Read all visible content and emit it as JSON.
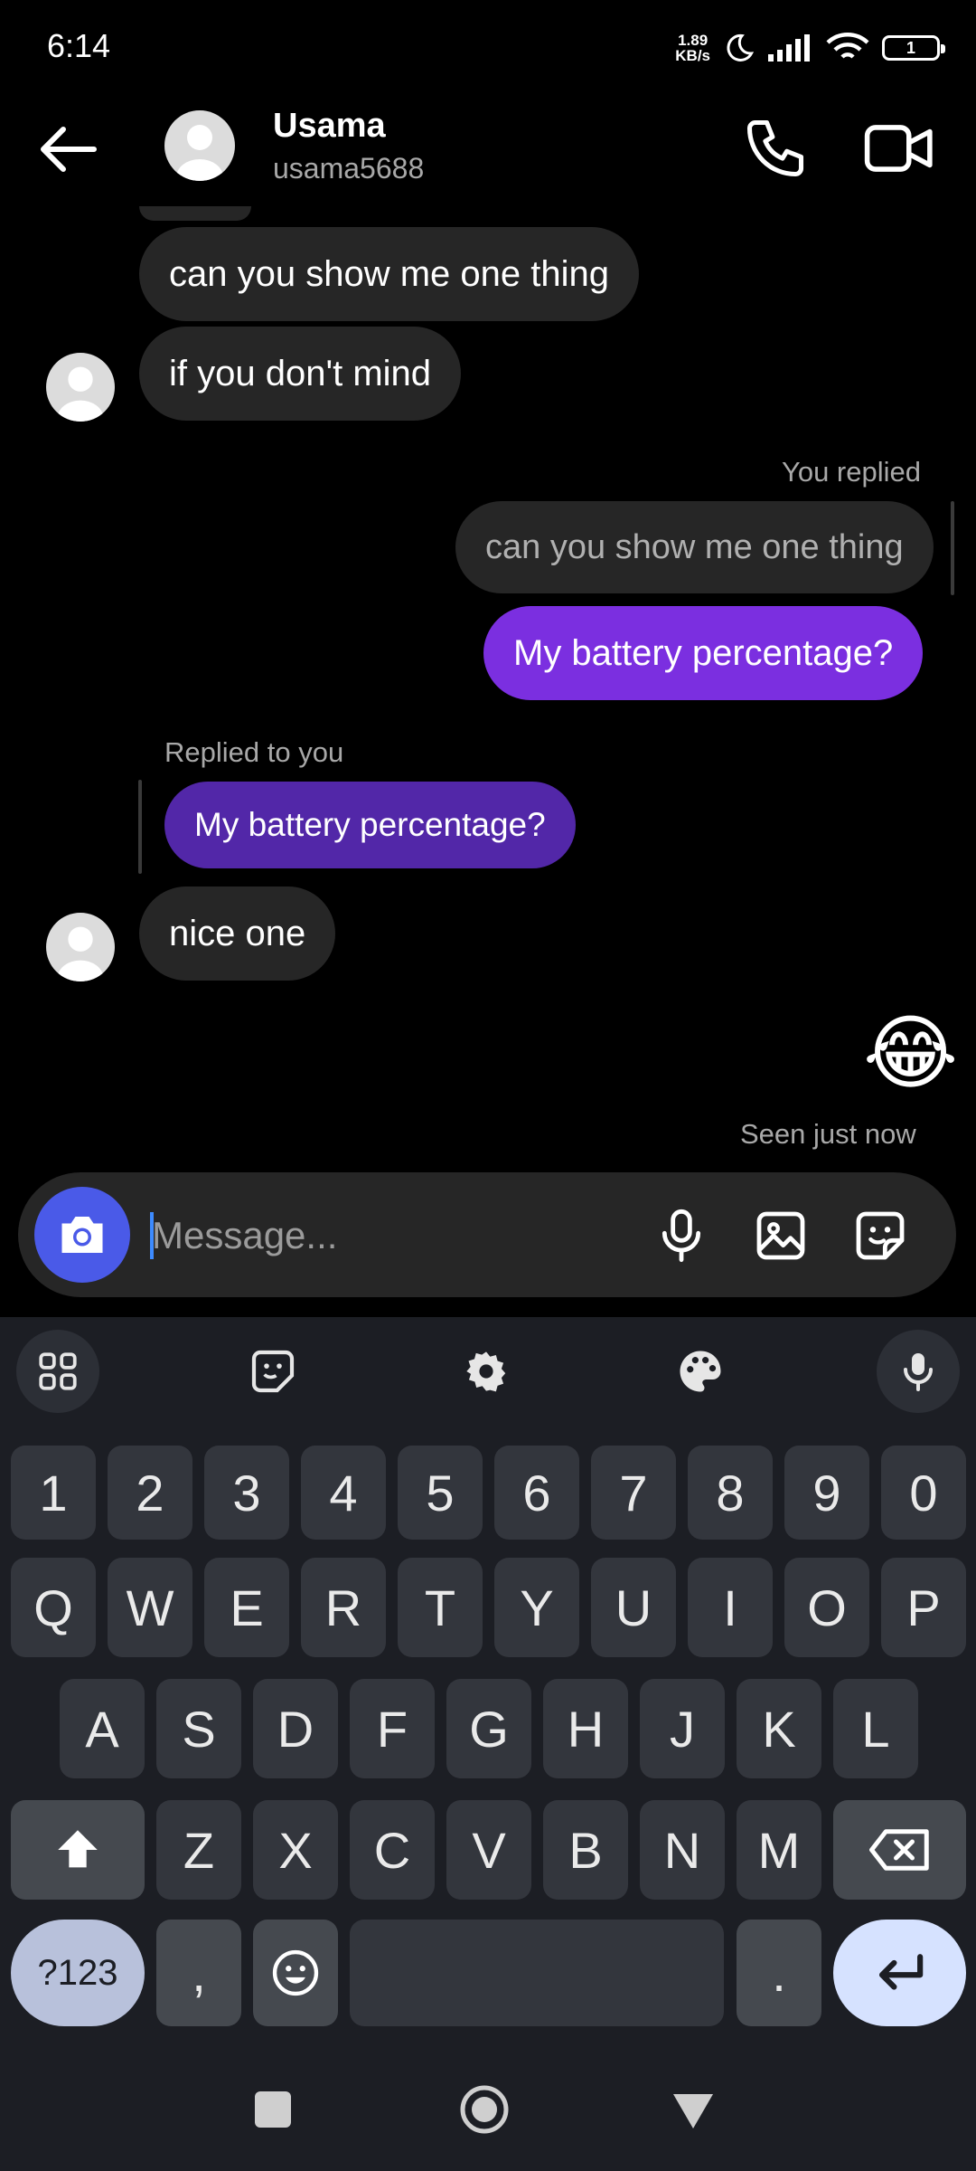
{
  "status_bar": {
    "time": "6:14",
    "net_speed_value": "1.89",
    "net_speed_unit": "KB/s",
    "battery_level": "1"
  },
  "header": {
    "name": "Usama",
    "username": "usama5688"
  },
  "messages": {
    "m1": "can you show me one thing",
    "m2": "if you don't mind",
    "you_replied_label": "You replied",
    "quoted_text": "can you show me one thing",
    "m3": "My battery percentage?",
    "replied_to_you_label": "Replied to you",
    "reply_quote": "My battery percentage?",
    "m4": "nice one",
    "emoji": "😂",
    "seen": "Seen just now"
  },
  "composer": {
    "placeholder": "Message..."
  },
  "keyboard": {
    "row_numbers": [
      "1",
      "2",
      "3",
      "4",
      "5",
      "6",
      "7",
      "8",
      "9",
      "0"
    ],
    "row_q": [
      "Q",
      "W",
      "E",
      "R",
      "T",
      "Y",
      "U",
      "I",
      "O",
      "P"
    ],
    "row_a": [
      "A",
      "S",
      "D",
      "F",
      "G",
      "H",
      "J",
      "K",
      "L"
    ],
    "row_z": [
      "Z",
      "X",
      "C",
      "V",
      "B",
      "N",
      "M"
    ],
    "symbols_key": "?123",
    "comma_key": ",",
    "period_key": "."
  },
  "colors": {
    "accent_purple": "#7b2fe0",
    "reply_purple": "#5227a8",
    "camera_blue": "#4a5ae8"
  }
}
